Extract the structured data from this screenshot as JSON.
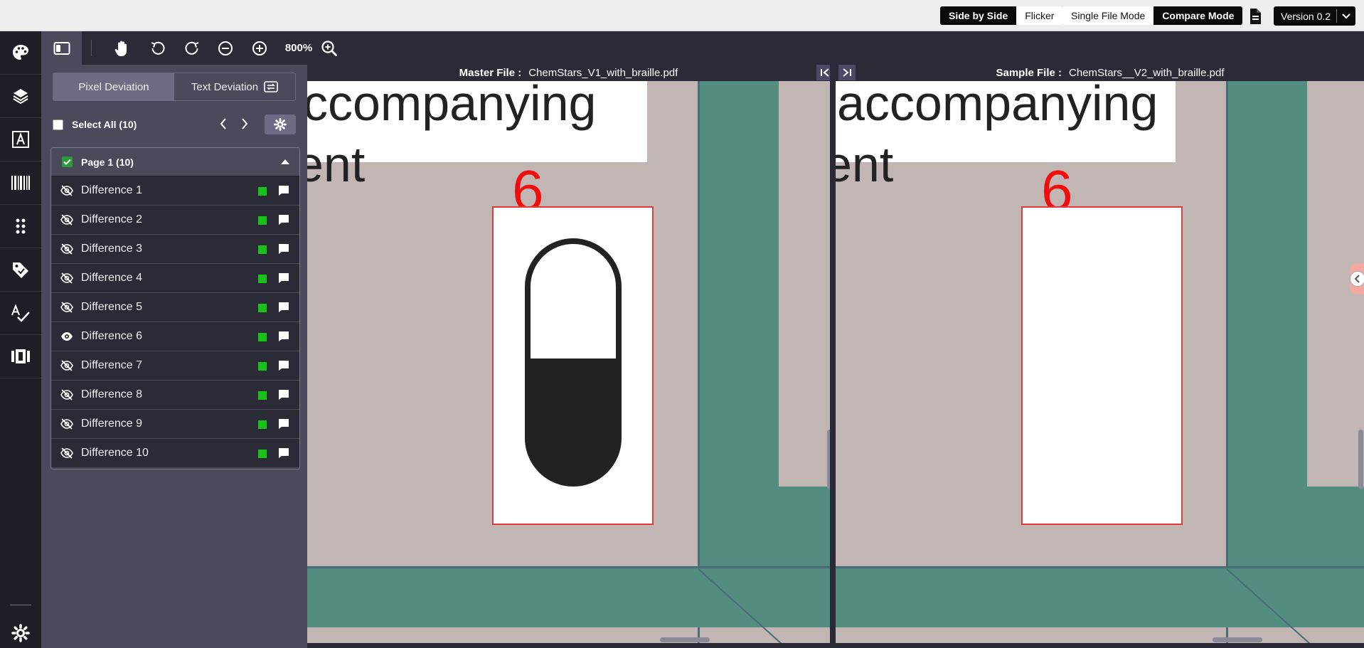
{
  "topbar": {
    "view_modes": [
      "Side by Side",
      "Flicker"
    ],
    "active_view": "Side by Side",
    "file_modes": [
      "Single File Mode",
      "Compare Mode"
    ],
    "active_file_mode": "Compare Mode",
    "version_label": "Version 0.2"
  },
  "rail": {
    "icons": [
      "palette-icon",
      "layers-icon",
      "text-icon",
      "barcode-icon",
      "braille-icon",
      "tag-icon",
      "spellcheck-icon",
      "compare-icon",
      "settings-icon"
    ]
  },
  "toolbar": {
    "zoom_label": "800%"
  },
  "panel": {
    "tabs": [
      {
        "label": "Pixel Deviation",
        "active": true
      },
      {
        "label": "Text Deviation",
        "active": false
      }
    ],
    "select_all_label": "Select All (10)",
    "group_label": "Page 1 (10)",
    "swatch_color": "#19c219",
    "differences": [
      {
        "label": "Difference 1",
        "visible": false
      },
      {
        "label": "Difference 2",
        "visible": false
      },
      {
        "label": "Difference 3",
        "visible": false
      },
      {
        "label": "Difference 4",
        "visible": false
      },
      {
        "label": "Difference 5",
        "visible": false
      },
      {
        "label": "Difference 6",
        "visible": true
      },
      {
        "label": "Difference 7",
        "visible": false
      },
      {
        "label": "Difference 8",
        "visible": false
      },
      {
        "label": "Difference 9",
        "visible": false
      },
      {
        "label": "Difference 10",
        "visible": false
      }
    ]
  },
  "master": {
    "label": "Master File :",
    "filename": "ChemStars_V1_with_braille.pdf",
    "text_line1": "ccompanying",
    "text_line2": "ent",
    "diff_number": "6"
  },
  "sample": {
    "label": "Sample File :",
    "filename": "ChemStars__V2_with_braille.pdf",
    "text_line1": "accompanying",
    "text_line2": "ent",
    "diff_number": "6"
  }
}
